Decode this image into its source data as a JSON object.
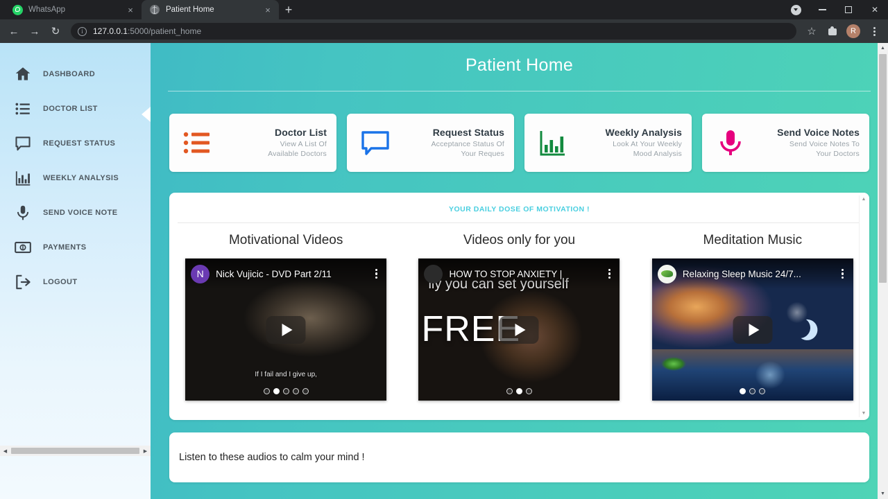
{
  "browser": {
    "tabs": [
      {
        "title": "WhatsApp",
        "favicon": "whatsapp-icon",
        "active": false,
        "close": "×"
      },
      {
        "title": "Patient Home",
        "favicon": "globe-icon",
        "active": true,
        "close": "×"
      }
    ],
    "new_tab_label": "+",
    "window_controls": {
      "minimize": "–",
      "maximize": "□",
      "close": "✕"
    },
    "toolbar": {
      "back": "←",
      "forward": "→",
      "reload": "↻",
      "url_host": "127.0.0.1",
      "url_rest": ":5000/patient_home",
      "url_full": "127.0.0.1:5000/patient_home",
      "bookmark": "☆",
      "extensions": "extensions-icon",
      "profile_initial": "R",
      "menu": "kebab-menu-icon"
    }
  },
  "sidebar": {
    "items": [
      {
        "label": "DASHBOARD",
        "icon": "home-icon"
      },
      {
        "label": "DOCTOR LIST",
        "icon": "list-icon"
      },
      {
        "label": "REQUEST STATUS",
        "icon": "chat-bubble-icon"
      },
      {
        "label": "WEEKLY ANALYSIS",
        "icon": "bar-chart-icon"
      },
      {
        "label": "SEND VOICE NOTE",
        "icon": "microphone-icon"
      },
      {
        "label": "PAYMENTS",
        "icon": "money-icon"
      },
      {
        "label": "LOGOUT",
        "icon": "logout-icon"
      }
    ]
  },
  "header": {
    "title": "Patient Home"
  },
  "cards": [
    {
      "title": "Doctor List",
      "subtitle": "View A List Of\nAvailable Doctors",
      "subtitle_line1": "View A List Of",
      "subtitle_line2": "Available Doctors",
      "icon": "bullet-list-icon",
      "color": "#e25822"
    },
    {
      "title": "Request Status",
      "subtitle_line1": "Acceptance Status Of",
      "subtitle_line2": "Your Reques",
      "icon": "chat-bubble-icon",
      "color": "#1a73e8"
    },
    {
      "title": "Weekly Analysis",
      "subtitle_line1": "Look At Your Weekly",
      "subtitle_line2": "Mood Analysis",
      "icon": "bar-chart-icon",
      "color": "#128a3e"
    },
    {
      "title": "Send Voice Notes",
      "subtitle_line1": "Send Voice Notes To",
      "subtitle_line2": "Your Doctors",
      "icon": "microphone-icon",
      "color": "#e6007e"
    }
  ],
  "motivation": {
    "heading": "YOUR DAILY DOSE OF MOTIVATION !",
    "heading_color": "#49cfe0",
    "columns": [
      {
        "title": "Motivational Videos",
        "video_title": "Nick Vujicic - DVD Part 2/11",
        "channel_initial": "N",
        "avatar_color": "#6a3ab2",
        "caption": "If I fail and I give up,",
        "dots_total": 5,
        "dots_active": 2
      },
      {
        "title": "Videos only for you",
        "video_title": "HOW TO STOP ANXIETY |",
        "overlay_text": "ily you can set yourself",
        "overlay_big": "FREE",
        "dots_total": 3,
        "dots_active": 2
      },
      {
        "title": "Meditation Music",
        "video_title": "Relaxing Sleep Music 24/7...",
        "channel_initial": "",
        "dots_total": 3,
        "dots_active": 1
      }
    ]
  },
  "audio_section": {
    "heading": "Listen to these audios to calm your mind !"
  },
  "scroll_arrows": {
    "up": "▲",
    "down": "▼",
    "left": "◀",
    "right": "▶"
  }
}
